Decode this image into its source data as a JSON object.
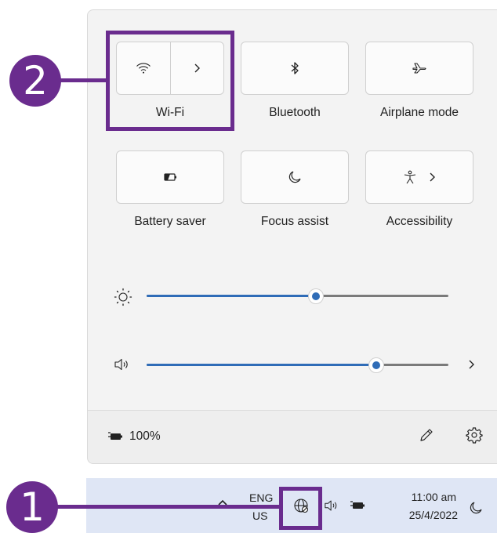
{
  "quick_settings": {
    "tiles": [
      {
        "label": "Wi-Fi",
        "icon": "wifi-icon",
        "expand_icon": "chevron-right-icon"
      },
      {
        "label": "Bluetooth",
        "icon": "bluetooth-icon"
      },
      {
        "label": "Airplane mode",
        "icon": "airplane-icon"
      },
      {
        "label": "Battery saver",
        "icon": "battery-saver-icon"
      },
      {
        "label": "Focus assist",
        "icon": "moon-icon"
      },
      {
        "label": "Accessibility",
        "icon": "accessibility-icon",
        "expand_icon": "chevron-right-icon"
      }
    ],
    "brightness": {
      "icon": "sun-icon",
      "level_percent": 56
    },
    "volume": {
      "icon": "speaker-icon",
      "level_percent": 76,
      "expand_icon": "chevron-right-icon"
    },
    "footer": {
      "battery_text": "100%",
      "battery_icon": "battery-charging-icon",
      "edit_icon": "pencil-icon",
      "settings_icon": "gear-icon"
    }
  },
  "taskbar": {
    "overflow_icon": "chevron-up-icon",
    "language_line1": "ENG",
    "language_line2": "US",
    "network_icon": "globe-no-internet-icon",
    "volume_icon": "speaker-icon",
    "battery_icon": "battery-charging-icon",
    "time": "11:00 am",
    "date": "25/4/2022",
    "focus_icon": "moon-icon"
  },
  "callouts": {
    "first": "1",
    "second": "2"
  },
  "colors": {
    "accent": "#2f6cb7",
    "callout": "#6a2c8e",
    "taskbar": "#dfe6f5",
    "panel": "#f3f3f3"
  }
}
